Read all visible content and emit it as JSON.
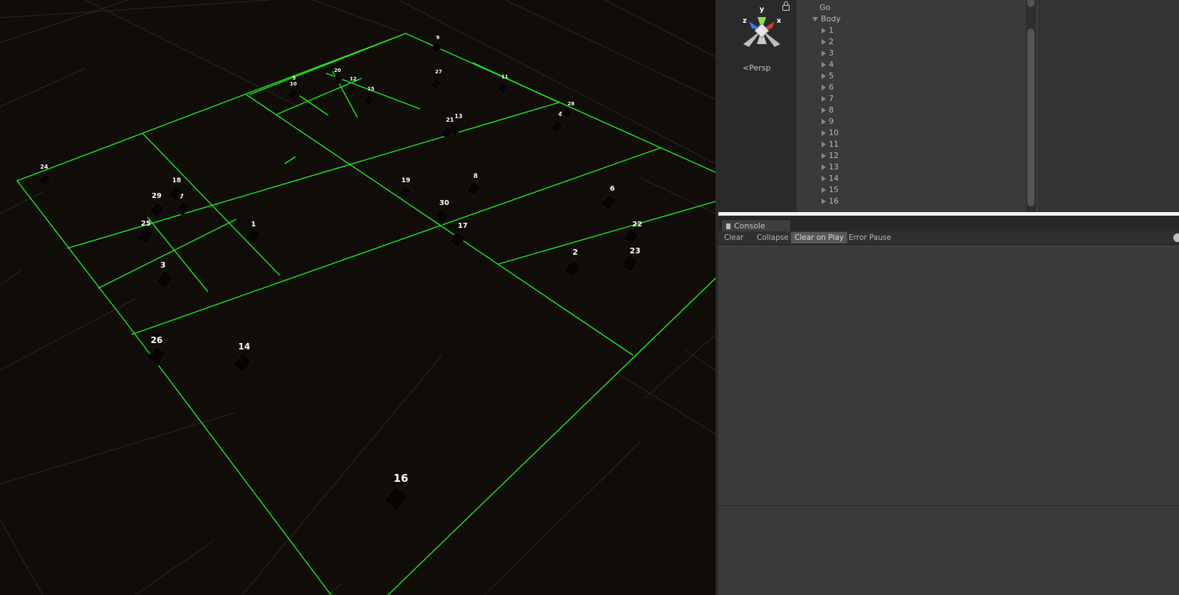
{
  "scene": {
    "gizmo": {
      "y": "y",
      "x": "x",
      "z": "z",
      "projection": "Persp"
    },
    "objects": [
      "1",
      "2",
      "3",
      "4",
      "5",
      "6",
      "7",
      "8",
      "9",
      "10",
      "11",
      "12",
      "13",
      "14",
      "15",
      "16",
      "17",
      "18",
      "19",
      "20",
      "21",
      "22",
      "23",
      "24",
      "25",
      "26",
      "27",
      "28",
      "29",
      "30"
    ]
  },
  "hierarchy": {
    "rows": [
      {
        "label": "Go",
        "arrow": "none",
        "indent": 1
      },
      {
        "label": "Body",
        "arrow": "down",
        "indent": 1
      },
      {
        "label": "1",
        "arrow": "right",
        "indent": 2
      },
      {
        "label": "2",
        "arrow": "right",
        "indent": 2
      },
      {
        "label": "3",
        "arrow": "right",
        "indent": 2
      },
      {
        "label": "4",
        "arrow": "right",
        "indent": 2
      },
      {
        "label": "5",
        "arrow": "right",
        "indent": 2
      },
      {
        "label": "6",
        "arrow": "right",
        "indent": 2
      },
      {
        "label": "7",
        "arrow": "right",
        "indent": 2
      },
      {
        "label": "8",
        "arrow": "right",
        "indent": 2
      },
      {
        "label": "9",
        "arrow": "right",
        "indent": 2
      },
      {
        "label": "10",
        "arrow": "right",
        "indent": 2
      },
      {
        "label": "11",
        "arrow": "right",
        "indent": 2
      },
      {
        "label": "12",
        "arrow": "right",
        "indent": 2
      },
      {
        "label": "13",
        "arrow": "right",
        "indent": 2
      },
      {
        "label": "14",
        "arrow": "right",
        "indent": 2
      },
      {
        "label": "15",
        "arrow": "right",
        "indent": 2
      },
      {
        "label": "16",
        "arrow": "right",
        "indent": 2
      }
    ]
  },
  "console": {
    "tab_label": "Console",
    "toolbar": {
      "clear": "Clear",
      "collapse": "Collapse",
      "clear_on_play": "Clear on Play",
      "error_pause": "Error Pause"
    }
  },
  "colors": {
    "octree_lines": "#1cf01c",
    "scene_background": "#100c07",
    "gizmo_y": "#8ce03c",
    "gizmo_x": "#e03c2c",
    "gizmo_z": "#3c78e0"
  }
}
